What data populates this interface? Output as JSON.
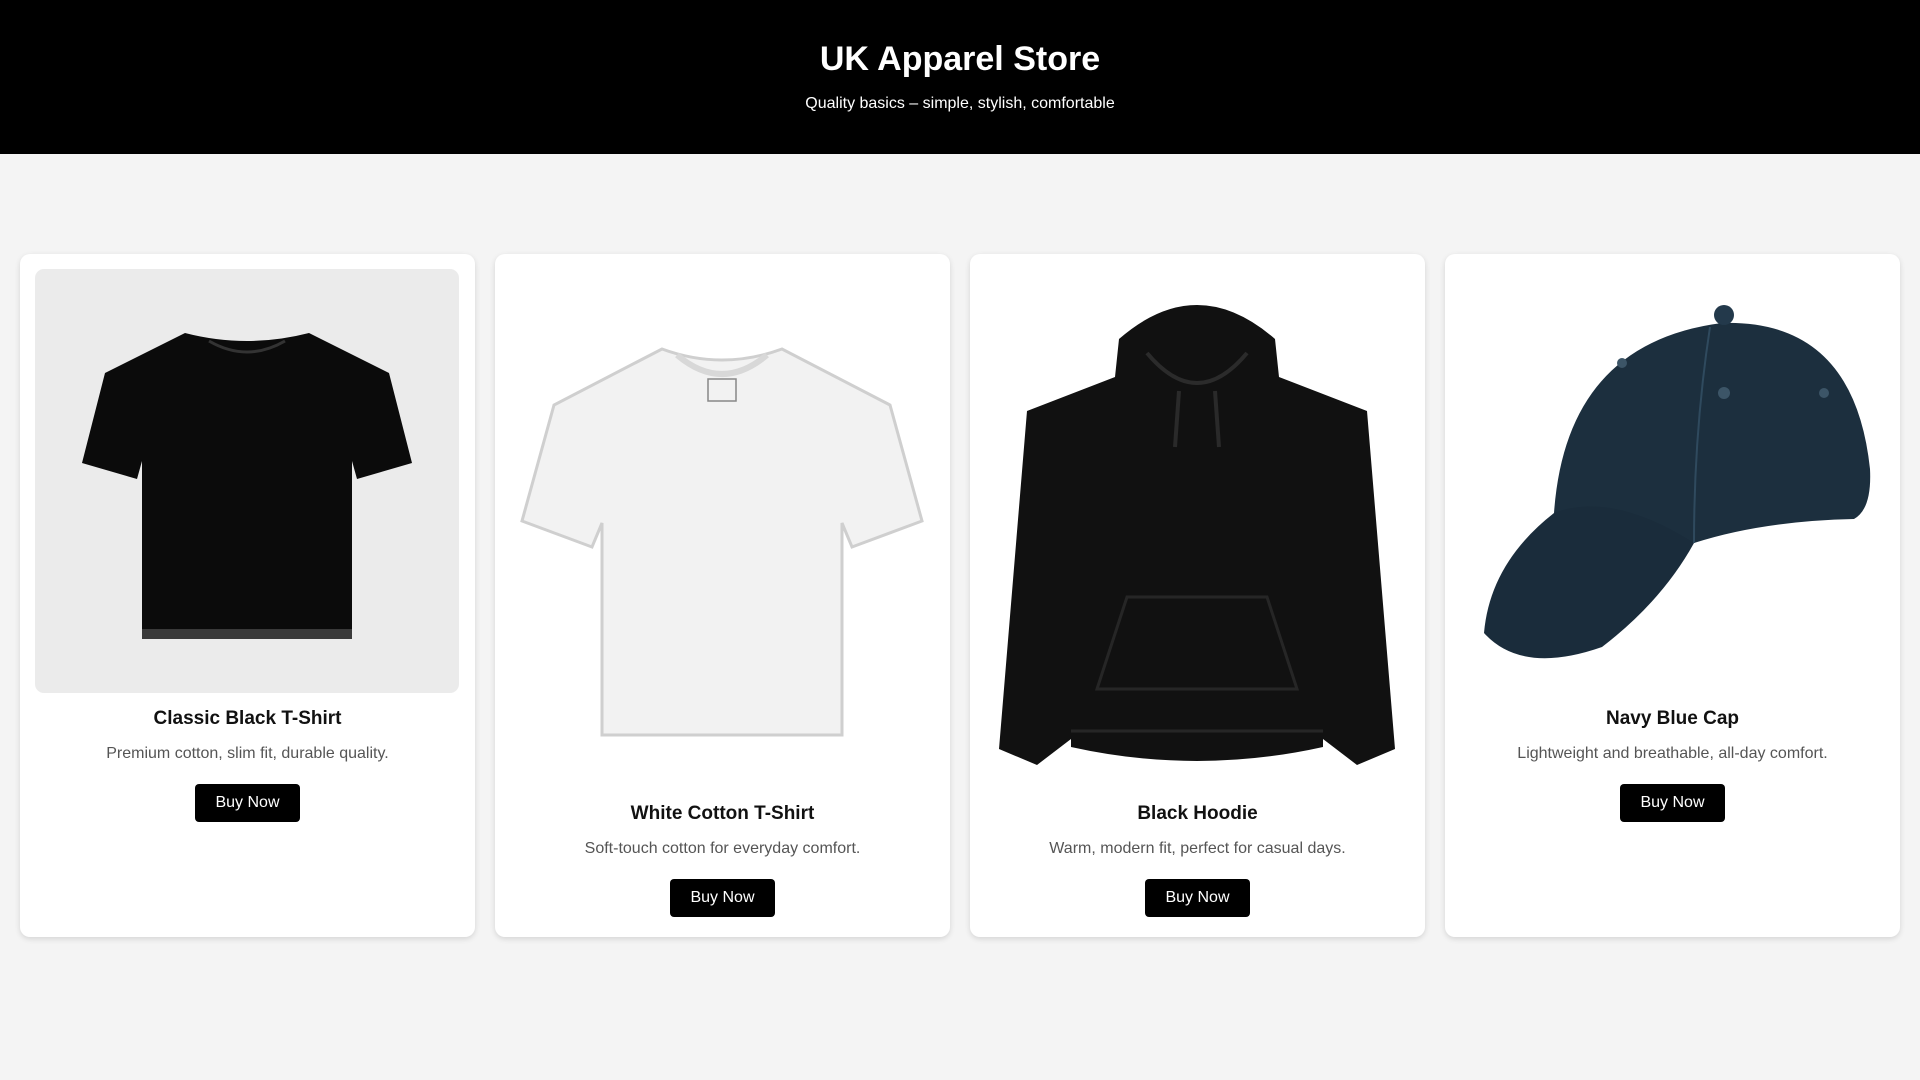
{
  "header": {
    "title": "UK Apparel Store",
    "tagline": "Quality basics – simple, stylish, comfortable"
  },
  "products": [
    {
      "name": "Classic Black T-Shirt",
      "description": "Premium cotton, slim fit, durable quality.",
      "button_label": "Buy Now",
      "image_icon": "black-tshirt-icon",
      "color": "#0b0b0b"
    },
    {
      "name": "White Cotton T-Shirt",
      "description": "Soft-touch cotton for everyday comfort.",
      "button_label": "Buy Now",
      "image_icon": "white-tshirt-icon",
      "color": "#f2f2f2"
    },
    {
      "name": "Black Hoodie",
      "description": "Warm, modern fit, perfect for casual days.",
      "button_label": "Buy Now",
      "image_icon": "black-hoodie-icon",
      "color": "#111111"
    },
    {
      "name": "Navy Blue Cap",
      "description": "Lightweight and breathable, all-day comfort.",
      "button_label": "Buy Now",
      "image_icon": "navy-cap-icon",
      "color": "#1c2f3e"
    }
  ],
  "colors": {
    "header_bg": "#000000",
    "page_bg": "#f4f4f4",
    "button_bg": "#000000",
    "button_text": "#ffffff"
  }
}
